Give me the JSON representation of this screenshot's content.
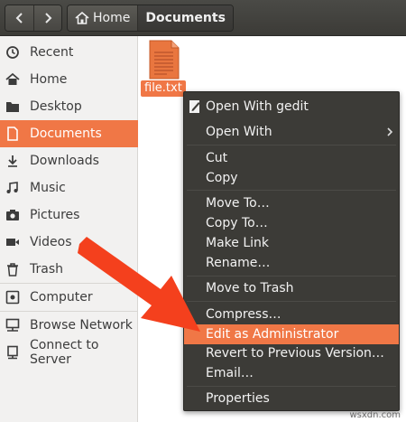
{
  "toolbar": {
    "back_icon": "chevron-left-icon",
    "forward_icon": "chevron-right-icon",
    "breadcrumbs": [
      {
        "label": "Home",
        "icon": "home-icon"
      },
      {
        "label": "Documents"
      }
    ]
  },
  "sidebar": {
    "items": [
      {
        "label": "Recent",
        "icon": "clock-icon"
      },
      {
        "label": "Home",
        "icon": "home-icon"
      },
      {
        "label": "Desktop",
        "icon": "folder-icon"
      },
      {
        "label": "Documents",
        "icon": "document-icon",
        "selected": true
      },
      {
        "label": "Downloads",
        "icon": "download-icon"
      },
      {
        "label": "Music",
        "icon": "music-icon"
      },
      {
        "label": "Pictures",
        "icon": "camera-icon"
      },
      {
        "label": "Videos",
        "icon": "video-icon"
      },
      {
        "label": "Trash",
        "icon": "trash-icon"
      },
      {
        "label": "Computer",
        "icon": "computer-icon"
      },
      {
        "label": "Browse Network",
        "icon": "network-icon"
      },
      {
        "label": "Connect to Server",
        "icon": "server-icon"
      }
    ]
  },
  "main": {
    "file": {
      "name": "file.txt",
      "icon": "text-file-icon"
    }
  },
  "context_menu": {
    "items": [
      {
        "label": "Open With gedit",
        "icon": "gedit-icon"
      },
      {
        "label": "Open With",
        "submenu": true
      },
      {
        "label": "Cut"
      },
      {
        "label": "Copy"
      },
      {
        "label": "Move To…"
      },
      {
        "label": "Copy To…"
      },
      {
        "label": "Make Link"
      },
      {
        "label": "Rename…"
      },
      {
        "label": "Move to Trash"
      },
      {
        "label": "Compress…"
      },
      {
        "label": "Edit as Administrator",
        "highlighted": true
      },
      {
        "label": "Revert to Previous Version…"
      },
      {
        "label": "Email…"
      },
      {
        "label": "Properties"
      }
    ]
  },
  "annotation": {
    "arrow_color": "#f4401d"
  },
  "colors": {
    "accent": "#f07746",
    "menu_bg": "#3c3b37",
    "toolbar_bg": "#3c3b37"
  },
  "watermark": "wsxdn.com"
}
